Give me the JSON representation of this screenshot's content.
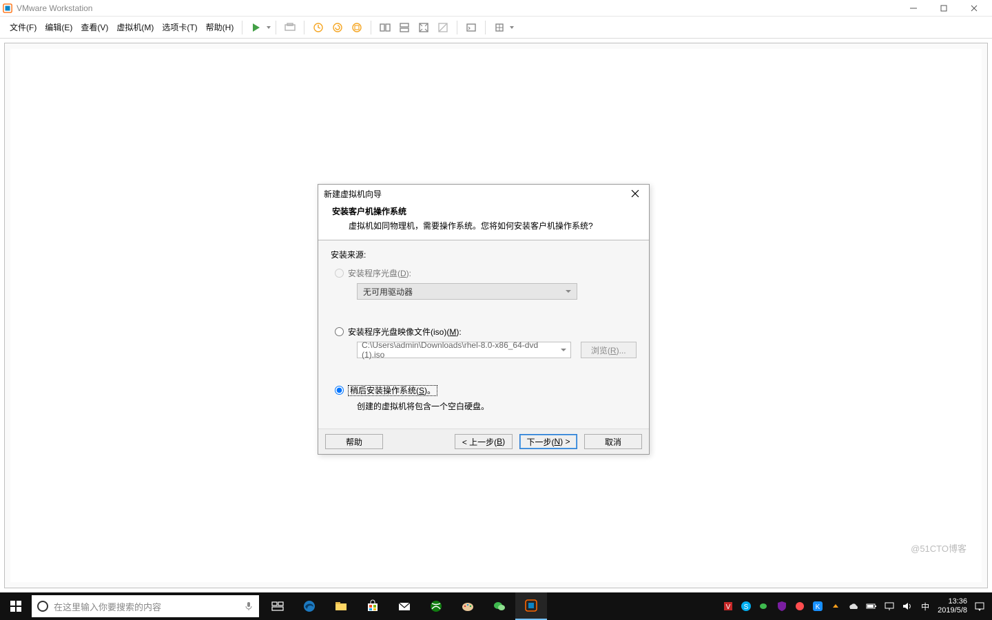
{
  "titlebar": {
    "app_title": "VMware Workstation"
  },
  "menu": {
    "file": "文件(F)",
    "edit": "编辑(E)",
    "view": "查看(V)",
    "vm": "虚拟机(M)",
    "tabs": "选项卡(T)",
    "help": "帮助(H)"
  },
  "dialog": {
    "title": "新建虚拟机向导",
    "header_title": "安装客户机操作系统",
    "header_sub": "虚拟机如同物理机，需要操作系统。您将如何安装客户机操作系统?",
    "section_label": "安装来源:",
    "opt_disc": "安装程序光盘(",
    "opt_disc_u": "D",
    "opt_disc_tail": "):",
    "drive_none": "无可用驱动器",
    "opt_iso": "安装程序光盘映像文件(iso)(",
    "opt_iso_u": "M",
    "opt_iso_tail": "):",
    "iso_path": "C:\\Users\\admin\\Downloads\\rhel-8.0-x86_64-dvd (1).iso",
    "browse_prefix": "浏览(",
    "browse_u": "R",
    "browse_tail": ")...",
    "opt_later": "稍后安装操作系统(",
    "opt_later_u": "S",
    "opt_later_tail": ")。",
    "later_note": "创建的虚拟机将包含一个空白硬盘。",
    "help": "帮助",
    "back_prefix": "< 上一步(",
    "back_u": "B",
    "back_tail": ")",
    "next_prefix": "下一步(",
    "next_u": "N",
    "next_tail": ") >",
    "cancel": "取消"
  },
  "taskbar": {
    "search_placeholder": "在这里输入你要搜索的内容",
    "ime": "中",
    "time": "13:36",
    "date": "2019/5/8"
  },
  "watermark": "@51CTO博客"
}
